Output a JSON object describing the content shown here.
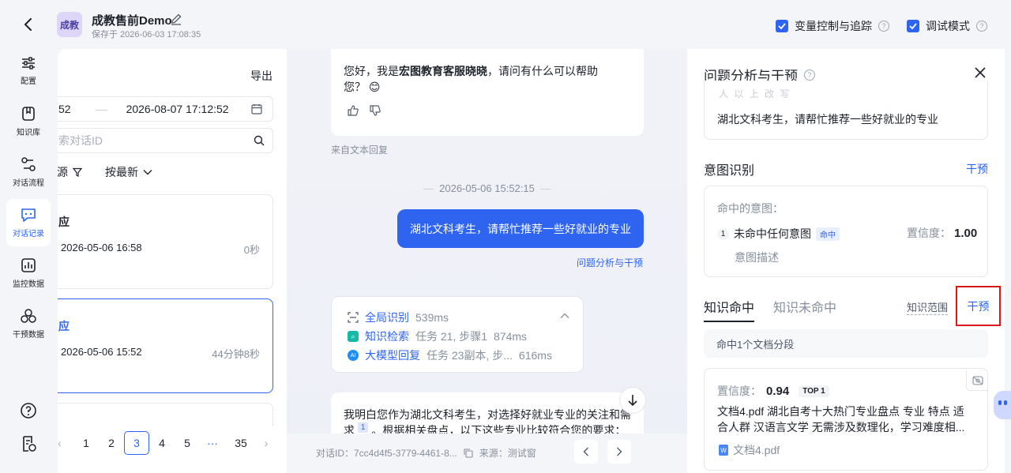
{
  "header": {
    "app_avatar": "成教",
    "app_title": "成教售前Demo",
    "saved": "保存于 2026-06-03 17:08:35",
    "toggle_variable": "变量控制与追踪",
    "toggle_debug": "调试模式"
  },
  "nav": [
    {
      "label": "配置",
      "icon": "sliders-icon"
    },
    {
      "label": "知识库",
      "icon": "bookmark-icon"
    },
    {
      "label": "对话流程",
      "icon": "flow-icon"
    },
    {
      "label": "对话记录",
      "icon": "chat-icon",
      "active": true
    },
    {
      "label": "监控数据",
      "icon": "chart-icon"
    },
    {
      "label": "干预数据",
      "icon": "circles-icon"
    }
  ],
  "list": {
    "export": "导出",
    "date_start": "52",
    "date_sep": "—",
    "date_end": "2026-08-07 17:12:52",
    "search_placeholder": "索对话ID",
    "filter_source": "源",
    "sort": "按最新",
    "items": [
      {
        "title": "应",
        "time": "2026-05-06 16:58",
        "duration": "0秒"
      },
      {
        "title": "应",
        "time": "2026-05-06 15:52",
        "duration": "44分钟8秒"
      }
    ],
    "pages": [
      "1",
      "2",
      "3",
      "4",
      "5",
      "···",
      "35"
    ],
    "current_page": "3"
  },
  "chat": {
    "greeting_pre": "您好，我是",
    "greeting_bold": "宏图教育客服晓晓",
    "greeting_post": "，请问有什么可以帮助您？",
    "emoji": "😊",
    "source_note": "来自文本回复",
    "timestamp": "2026-05-06 15:52:15",
    "user_msg": "湖北文科考生，请帮忙推荐一些好就业的专业",
    "analysis_link": "问题分析与干预",
    "steps": [
      {
        "name": "全局识别",
        "detail": "",
        "time": "539ms"
      },
      {
        "name": "知识检索",
        "detail": "任务 21, 步骤1",
        "time": "874ms"
      },
      {
        "name": "大模型回复",
        "detail": "任务 23副本, 步...",
        "time": "616ms"
      }
    ],
    "reply_line1": "我明白您作为湖北文科考生，对选择好就业专业的关注和需",
    "reply_line2_pre": "求",
    "reply_ref": "1",
    "reply_line2_post": "。根据相关盘点，以下这些专业比较符合您的要求：",
    "footer_id": "对话ID：7cc4d4f5-3779-4461-8...",
    "footer_source": "来源：测试窗"
  },
  "panel": {
    "title": "问题分析与干预",
    "partial_label": "人 以 上 改 写",
    "rewritten_query": "湖北文科考生，请帮忙推荐一些好就业的专业",
    "intent_title": "意图识别",
    "intent_action": "干预",
    "intent_hit_label": "命中的意图：",
    "intent_index": "1",
    "intent_name": "未命中任何意图",
    "intent_tag": "命中",
    "confidence_label": "置信度：",
    "confidence_value": "1.00",
    "intent_desc": "意图描述",
    "tab_hit": "知识命中",
    "tab_miss": "知识未命中",
    "knowledge_scope": "知识范围",
    "knowledge_action": "干预",
    "hit_summary": "命中1个文档分段",
    "doc_conf_label": "置信度：",
    "doc_conf_value": "0.94",
    "doc_rank": "TOP 1",
    "doc_text": "文档4.pdf 湖北自考十大热门专业盘点 专业 特点 适合人群 汉语言文学 无需涉及数理化，学习难度相...",
    "doc_file": "文档4.pdf"
  }
}
